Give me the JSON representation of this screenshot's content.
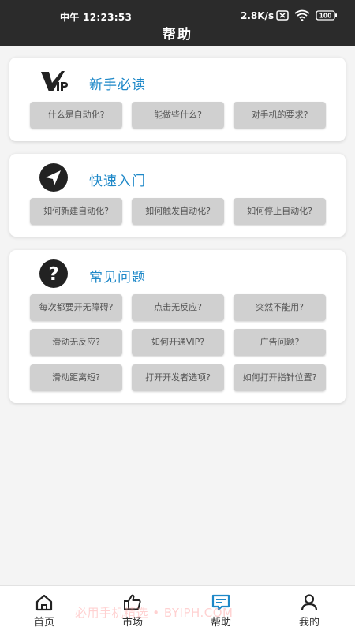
{
  "status_bar": {
    "time": "中午 12:23:53",
    "network_speed": "2.8K/s",
    "battery": "100"
  },
  "header": {
    "title": "帮助"
  },
  "sections": [
    {
      "title": "新手必读",
      "icon": "vip-icon",
      "items": [
        "什么是自动化?",
        "能做些什么?",
        "对手机的要求?"
      ]
    },
    {
      "title": "快速入门",
      "icon": "navigation-arrow-icon",
      "items": [
        "如何新建自动化?",
        "如何触发自动化?",
        "如何停止自动化?"
      ]
    },
    {
      "title": "常见问题",
      "icon": "question-icon",
      "items": [
        "每次都要开无障碍?",
        "点击无反应?",
        "突然不能用?",
        "滑动无反应?",
        "如何开通VIP?",
        "广告问题?",
        "滑动距离短?",
        "打开开发者选项?",
        "如何打开指针位置?"
      ]
    }
  ],
  "bottom_nav": {
    "items": [
      "首页",
      "市场",
      "帮助",
      "我的"
    ],
    "active": "帮助"
  },
  "watermark": "必用手机精选 • BYIPH.COM",
  "colors": {
    "accent": "#1e88c8",
    "bar": "#2b2b2b",
    "chip": "#d0d0d0",
    "nav_active": "#1e88c8"
  }
}
